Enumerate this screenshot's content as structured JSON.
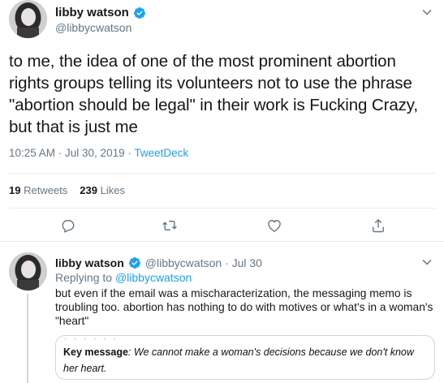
{
  "main_tweet": {
    "display_name": "libby watson",
    "handle": "@libbycwatson",
    "text": "to me, the idea of one of the most prominent abortion rights groups telling its volunteers not to use the phrase \"abortion should be legal\" in their work is Fucking Crazy, but that is just me",
    "timestamp": "10:25 AM · Jul 30, 2019 · ",
    "source": "TweetDeck",
    "retweets_count": "19",
    "retweets_label": "Retweets",
    "likes_count": "239",
    "likes_label": "Likes"
  },
  "reply_tweet": {
    "display_name": "libby watson",
    "handle_time": "@libbycwatson · Jul 30",
    "replying_prefix": "Replying to ",
    "replying_mention": "@libbycwatson",
    "text": "but even if the email was a mischaracterization, the messaging memo is troubling too. abortion has nothing to do with motives or what's in a woman's \"heart\"",
    "quote_key": "Key message",
    "quote_body": ": We cannot make a woman's decisions because we don't know her heart."
  },
  "icons": {
    "verified": "verified-badge-icon",
    "caret": "chevron-down-icon",
    "reply": "reply-icon",
    "retweet": "retweet-icon",
    "like": "heart-icon",
    "share": "share-icon"
  },
  "colors": {
    "accent": "#1da1f2",
    "muted": "#657786",
    "text": "#14171a",
    "border": "#e6ecf0"
  }
}
